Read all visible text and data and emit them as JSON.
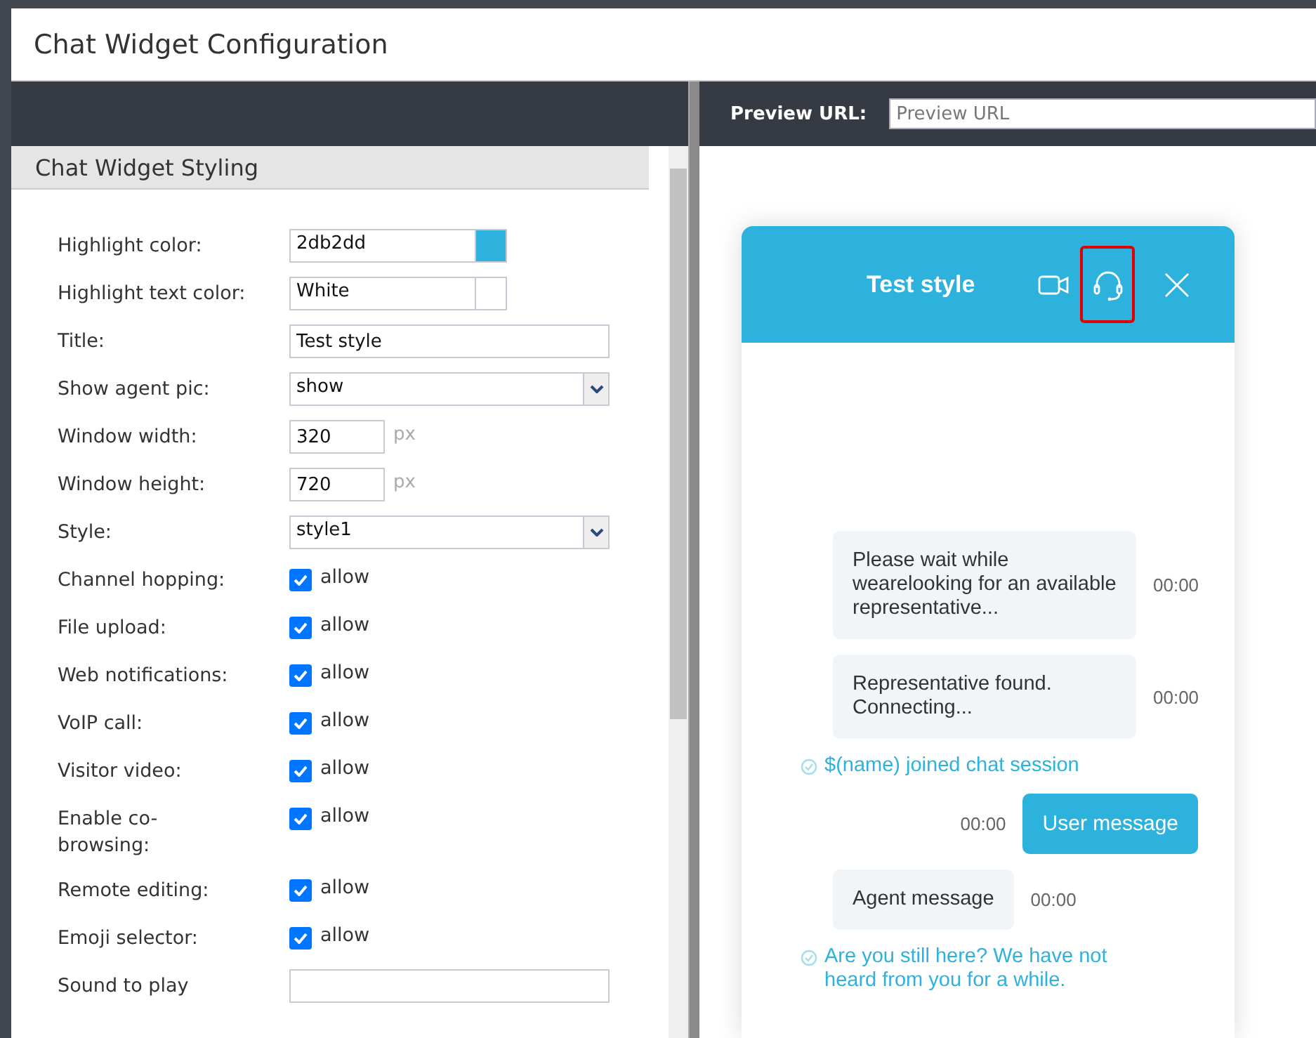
{
  "window": {
    "title": "Chat Widget Configuration"
  },
  "section": {
    "title": "Chat Widget Styling"
  },
  "form": [
    {
      "label": "Highlight color:",
      "kind": "color",
      "value": "2db2dd",
      "color": "#2db2dd"
    },
    {
      "label": "Highlight text color:",
      "kind": "color",
      "value": "White",
      "color": "#ffffff"
    },
    {
      "label": "Title:",
      "kind": "text",
      "value": "Test style"
    },
    {
      "label": "Show agent pic:",
      "kind": "select",
      "value": "show"
    },
    {
      "label": "Window width:",
      "kind": "number",
      "value": "320",
      "unit": "px"
    },
    {
      "label": "Window height:",
      "kind": "number",
      "value": "720",
      "unit": "px"
    },
    {
      "label": "Style:",
      "kind": "select",
      "value": "style1"
    },
    {
      "label": "Channel hopping:",
      "kind": "checkbox",
      "checked": true,
      "option": "allow"
    },
    {
      "label": "File upload:",
      "kind": "checkbox",
      "checked": true,
      "option": "allow"
    },
    {
      "label": "Web notifications:",
      "kind": "checkbox",
      "checked": true,
      "option": "allow"
    },
    {
      "label": "VoIP call:",
      "kind": "checkbox",
      "checked": true,
      "option": "allow"
    },
    {
      "label": "Visitor video:",
      "kind": "checkbox",
      "checked": true,
      "option": "allow"
    },
    {
      "label": "Enable co-browsing:",
      "kind": "checkbox",
      "checked": true,
      "option": "allow"
    },
    {
      "label": "Remote editing:",
      "kind": "checkbox",
      "checked": true,
      "option": "allow"
    },
    {
      "label": "Emoji selector:",
      "kind": "checkbox",
      "checked": true,
      "option": "allow"
    },
    {
      "label": "Sound to play",
      "kind": "text"
    }
  ],
  "preview": {
    "label": "Preview URL:",
    "placeholder": "Preview URL"
  },
  "widget": {
    "title": "Test style",
    "header_buttons": [
      {
        "kind": "video",
        "highlighted": false
      },
      {
        "kind": "headset",
        "highlighted": true
      },
      {
        "kind": "close",
        "highlighted": false
      }
    ],
    "messages": [
      {
        "kind": "agent",
        "text": "Please wait while wearelooking for an available representative...",
        "time": "00:00"
      },
      {
        "kind": "agent",
        "text": "Representative found. Connecting...",
        "time": "00:00"
      },
      {
        "kind": "system",
        "text": "$(name) joined chat session"
      },
      {
        "kind": "user",
        "text": "User message",
        "time": "00:00"
      },
      {
        "kind": "agent",
        "text": "Agent message",
        "time": "00:00"
      },
      {
        "kind": "system",
        "text": "Are you still here? We have not heard from you for a while."
      }
    ]
  }
}
